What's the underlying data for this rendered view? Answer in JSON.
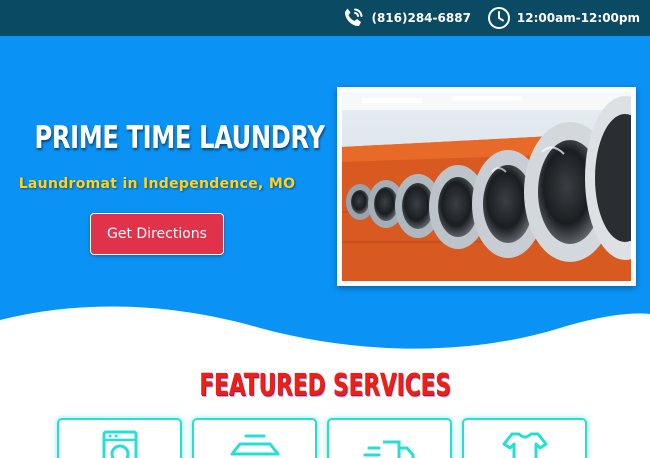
{
  "topbar": {
    "phone": "(816)284-6887",
    "hours": "12:00am-12:00pm",
    "phone_icon": "phone-icon",
    "hours_icon": "clock-icon"
  },
  "hero": {
    "title": "PRIME TIME LAUNDRY",
    "subtitle": "Laundromat in Independence, MO",
    "button_label": "Get Directions",
    "image": "laundromat-washers-photo"
  },
  "services": {
    "heading": "FEATURED SERVICES",
    "cards": [
      {
        "icon": "washing-machine-icon"
      },
      {
        "icon": "folded-clothes-icon"
      },
      {
        "icon": "delivery-truck-icon"
      },
      {
        "icon": "shirt-icon"
      }
    ]
  },
  "colors": {
    "topbar": "#0b4a63",
    "hero": "#0a93f5",
    "accent_yellow": "#ffd21f",
    "button": "#e0324a",
    "heading_red": "#f0200e",
    "card_border": "#25e0d2"
  }
}
